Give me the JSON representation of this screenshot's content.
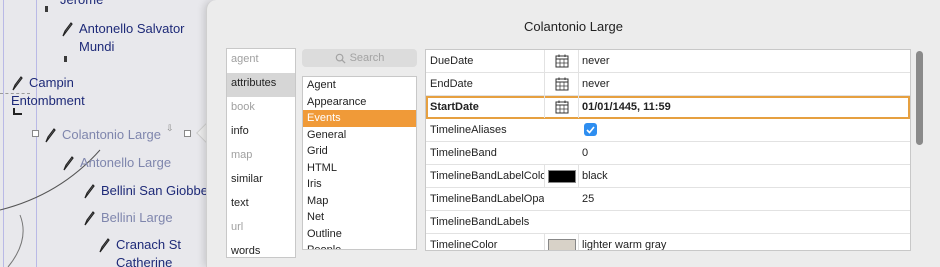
{
  "canvas": {
    "notes": [
      {
        "id": "partial-top",
        "lines": [
          "Jerome"
        ]
      },
      {
        "id": "antonello-salvator",
        "lines": [
          "Antonello Salvator",
          "Mundi"
        ]
      },
      {
        "id": "campin",
        "lines": [
          "Campin",
          "Entombment"
        ]
      },
      {
        "id": "colantonio",
        "lines": [
          "Colantonio Large"
        ]
      },
      {
        "id": "antonello-large",
        "lines": [
          "Antonello Large"
        ]
      },
      {
        "id": "bellini-san",
        "lines": [
          "Bellini San Giobbe"
        ]
      },
      {
        "id": "bellini-large",
        "lines": [
          "Bellini Large"
        ]
      },
      {
        "id": "cranach",
        "lines": [
          "Cranach St",
          "Catherine"
        ]
      }
    ]
  },
  "inspector": {
    "title": "Colantonio Large",
    "categories": [
      {
        "label": "agent",
        "state": "disabled"
      },
      {
        "label": "attributes",
        "state": "selected"
      },
      {
        "label": "book",
        "state": "disabled"
      },
      {
        "label": "info",
        "state": "normal"
      },
      {
        "label": "map",
        "state": "disabled"
      },
      {
        "label": "similar",
        "state": "normal"
      },
      {
        "label": "text",
        "state": "normal"
      },
      {
        "label": "url",
        "state": "disabled"
      },
      {
        "label": "words",
        "state": "normal"
      }
    ],
    "search_placeholder": "Search",
    "attribute_groups": [
      "Agent",
      "Appearance",
      "Events",
      "General",
      "Grid",
      "HTML",
      "Iris",
      "Map",
      "Net",
      "Outline",
      "People"
    ],
    "selected_group": "Events",
    "rows": [
      {
        "name": "DueDate",
        "control": "calendar",
        "value": "never"
      },
      {
        "name": "EndDate",
        "control": "calendar",
        "value": "never"
      },
      {
        "name": "StartDate",
        "control": "calendar",
        "value": "01/01/1445, 11:59",
        "highlighted": true
      },
      {
        "name": "TimelineAliases",
        "control": "checkbox-checked",
        "value": ""
      },
      {
        "name": "TimelineBand",
        "control": "none",
        "value": "0"
      },
      {
        "name": "TimelineBandLabelColo",
        "control": "swatch",
        "swatch_color": "#000000",
        "value": "black"
      },
      {
        "name": "TimelineBandLabelOpa",
        "control": "none",
        "value": "25"
      },
      {
        "name": "TimelineBandLabels",
        "control": "none",
        "value": ""
      },
      {
        "name": "TimelineColor",
        "control": "swatch",
        "swatch_color": "#d8d2c8",
        "value": "lighter warm gray"
      }
    ]
  },
  "colors": {
    "accent": "#f09a38",
    "highlight_border": "#e6a040",
    "checkbox": "#2e8ef0",
    "note_text": "#1e2a78"
  }
}
